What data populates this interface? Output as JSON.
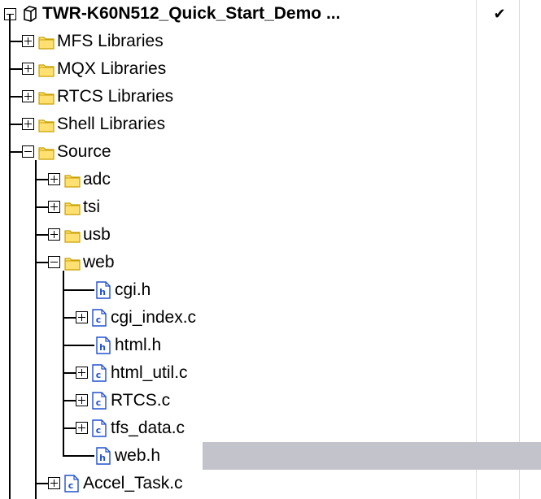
{
  "project": {
    "title": "TWR-K60N512_Quick_Start_Demo ...",
    "target_checked": true,
    "check_mark": "✔"
  },
  "tree_items": [
    {
      "label": "MFS Libraries",
      "type": "folder",
      "expander": "plus",
      "depth": 1
    },
    {
      "label": "MQX Libraries",
      "type": "folder",
      "expander": "plus",
      "depth": 1
    },
    {
      "label": "RTCS Libraries",
      "type": "folder",
      "expander": "plus",
      "depth": 1
    },
    {
      "label": "Shell Libraries",
      "type": "folder",
      "expander": "plus",
      "depth": 1
    },
    {
      "label": "Source",
      "type": "folder",
      "expander": "minus",
      "depth": 1
    },
    {
      "label": "adc",
      "type": "folder",
      "expander": "plus",
      "depth": 2
    },
    {
      "label": "tsi",
      "type": "folder",
      "expander": "plus",
      "depth": 2
    },
    {
      "label": "usb",
      "type": "folder",
      "expander": "plus",
      "depth": 2
    },
    {
      "label": "web",
      "type": "folder",
      "expander": "minus",
      "depth": 2
    },
    {
      "label": "cgi.h",
      "type": "header",
      "expander": "none",
      "depth": 3
    },
    {
      "label": "cgi_index.c",
      "type": "source",
      "expander": "plus",
      "depth": 3
    },
    {
      "label": "html.h",
      "type": "header",
      "expander": "none",
      "depth": 3
    },
    {
      "label": "html_util.c",
      "type": "source",
      "expander": "plus",
      "depth": 3
    },
    {
      "label": "RTCS.c",
      "type": "source",
      "expander": "plus",
      "depth": 3
    },
    {
      "label": "tfs_data.c",
      "type": "source",
      "expander": "plus",
      "depth": 3
    },
    {
      "label": "web.h",
      "type": "header",
      "expander": "none",
      "depth": 3,
      "selected": true
    },
    {
      "label": "Accel_Task.c",
      "type": "source",
      "expander": "plus",
      "depth": 2
    }
  ],
  "colors": {
    "selection": "#c3c3cb",
    "folder_fill": "#ffe070",
    "folder_edge": "#c8a000",
    "file_icon": "#2050d0"
  },
  "icons": {
    "project": "cube-icon",
    "folder": "folder-icon",
    "header": "header-file-icon",
    "source": "c-file-icon",
    "plus": "expand-plus-icon",
    "minus": "collapse-minus-icon"
  }
}
